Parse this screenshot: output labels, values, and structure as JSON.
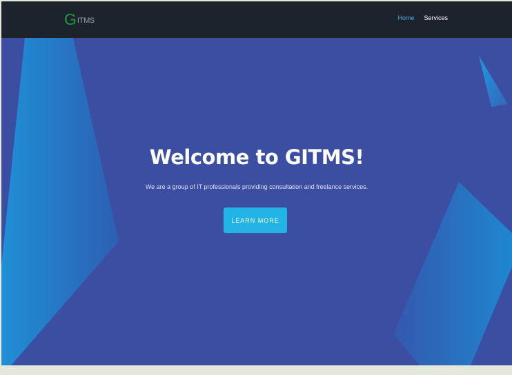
{
  "brand": {
    "logo_initial": "G",
    "logo_rest": "ITMS",
    "logo_initial_color": "#1f9b3c"
  },
  "nav": {
    "items": [
      {
        "label": "Home",
        "active": true
      },
      {
        "label": "Services",
        "active": false
      }
    ],
    "active_color": "#4aa9de"
  },
  "hero": {
    "title": "Welcome to GITMS!",
    "subtitle": "We are a group of IT professionals providing consultation and freelance services.",
    "button_label": "LEARN MORE",
    "background_color": "#3c4ea2",
    "button_color": "#23b4e6"
  }
}
